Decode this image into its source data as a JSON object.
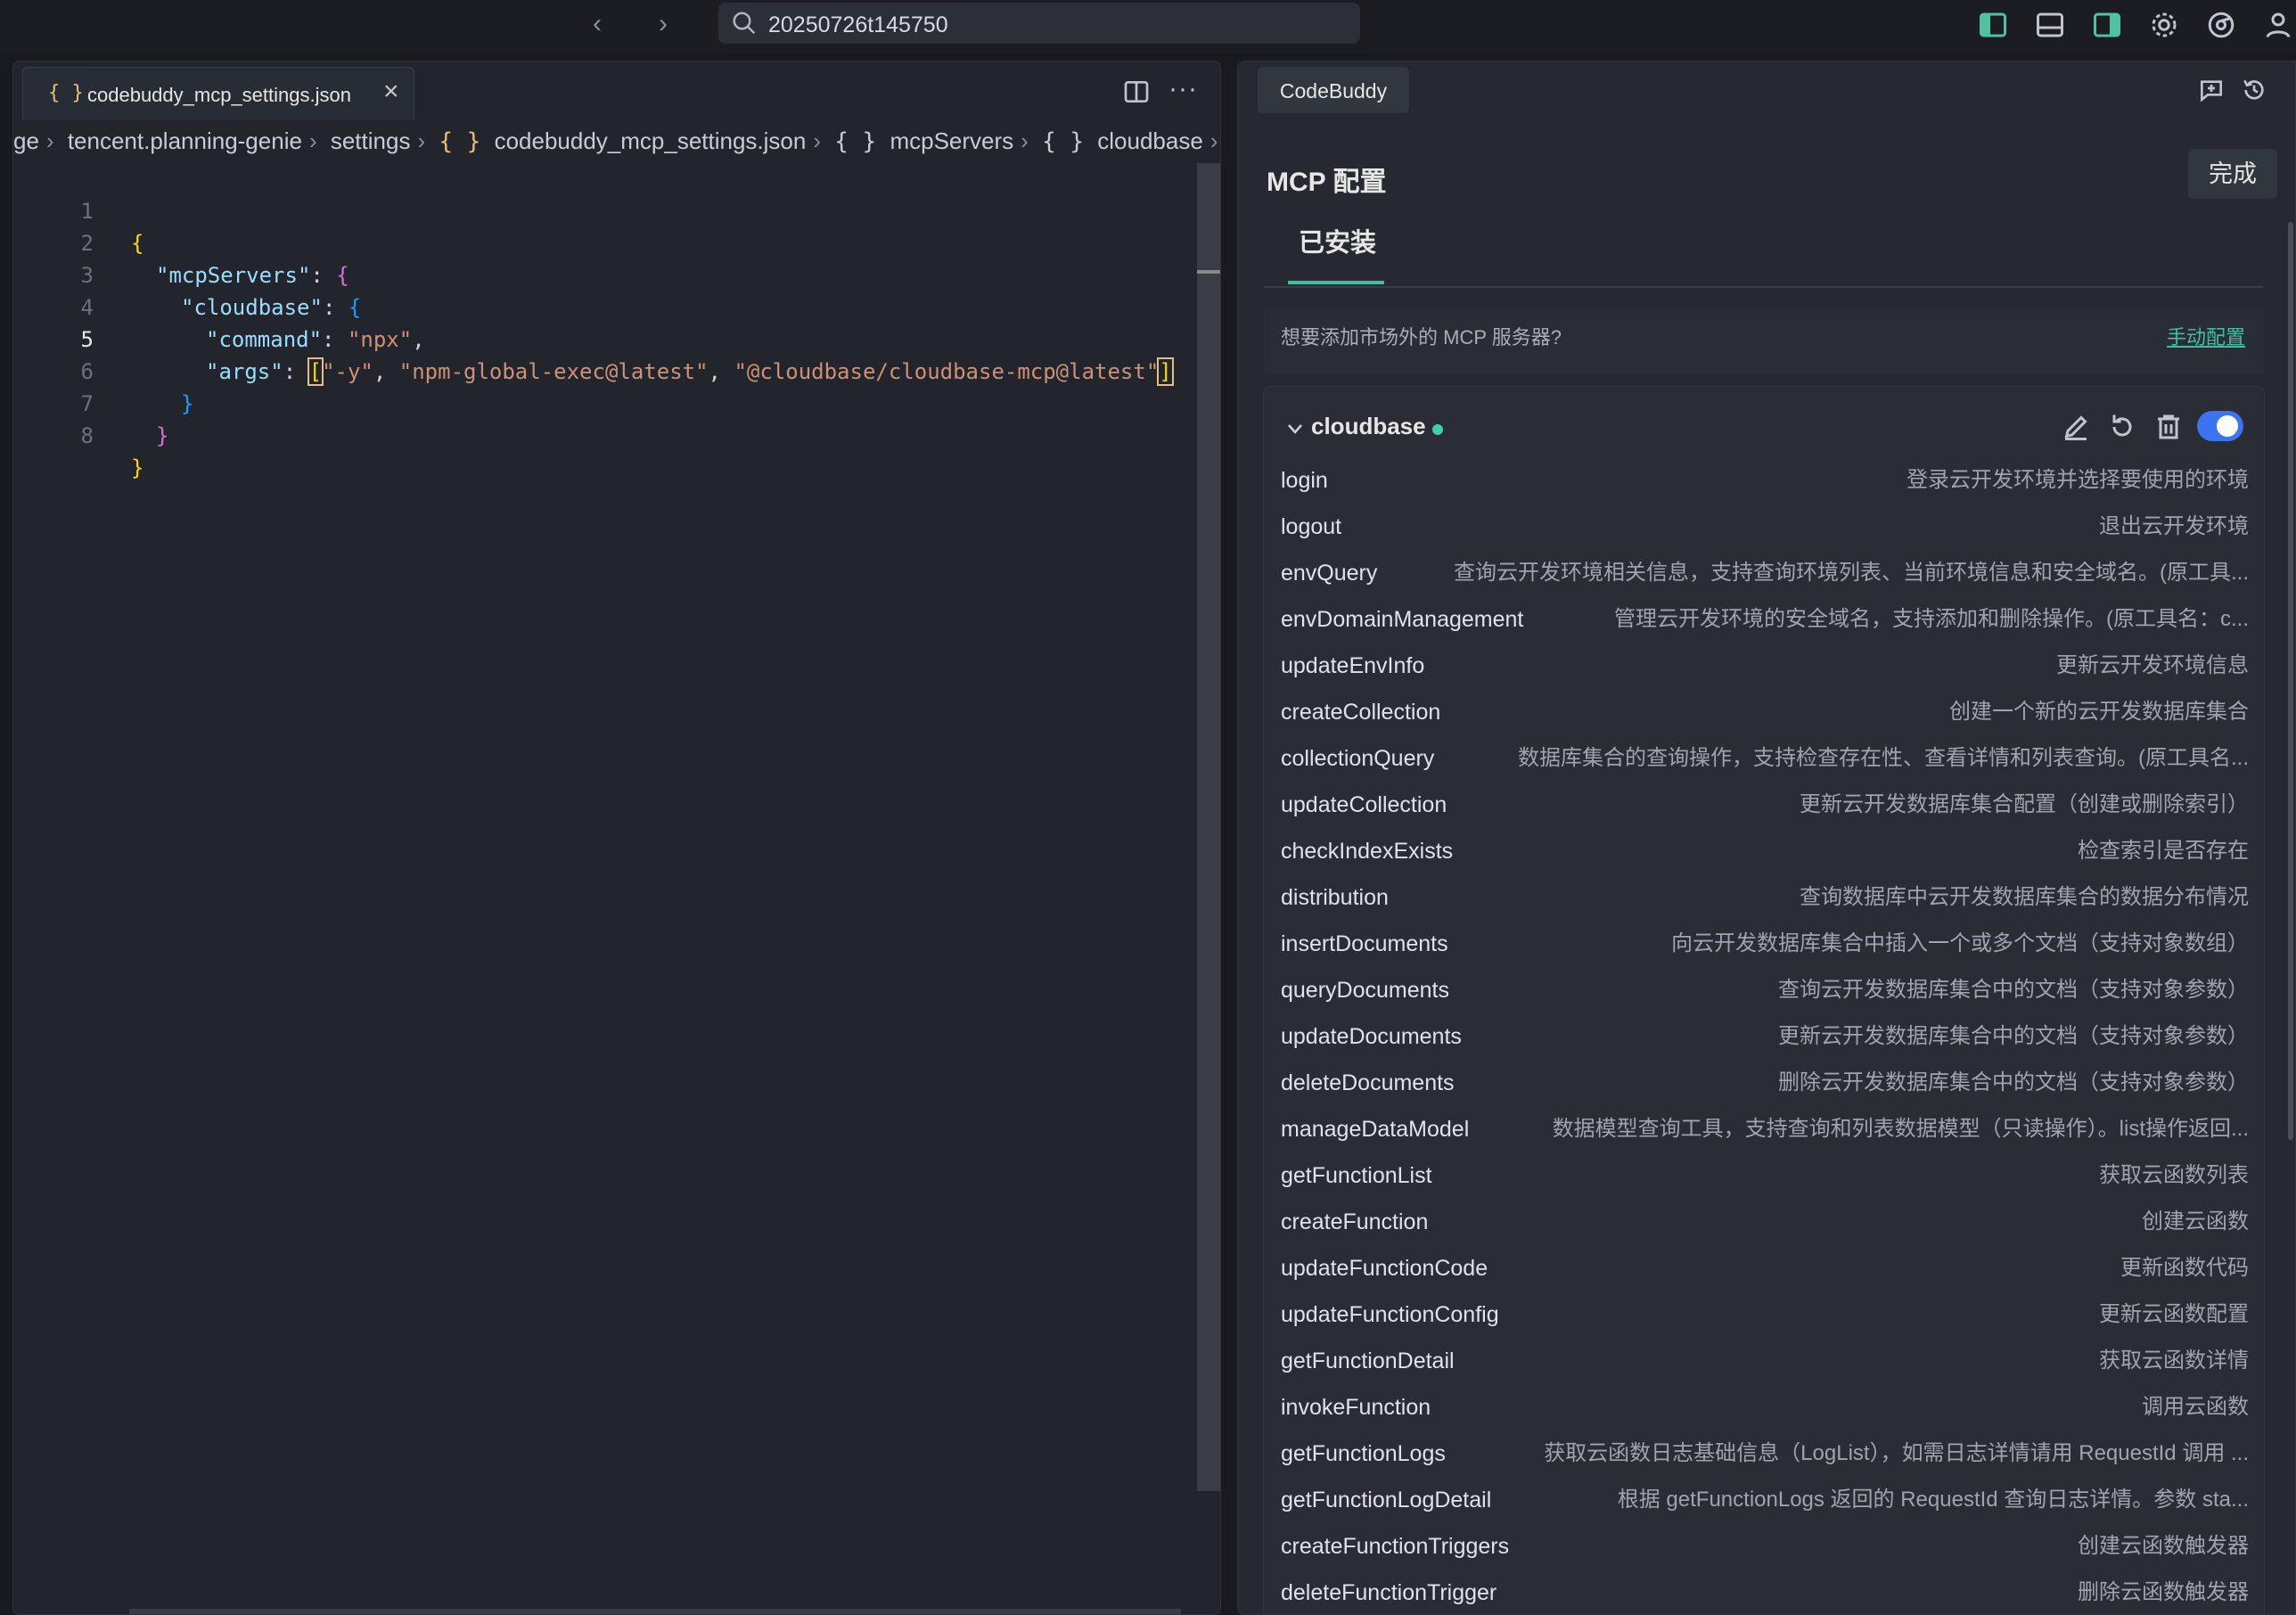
{
  "titlebar": {
    "search_text": "20250726t145750"
  },
  "editor": {
    "tab_icon": "{ }",
    "tab_name": "codebuddy_mcp_settings.json",
    "breadcrumb": [
      "ge",
      "tencent.planning-genie",
      "settings",
      "codebuddy_mcp_settings.json",
      "mcpServers",
      "cloudbase"
    ],
    "breadcrumb_icons": [
      "{ }",
      "{ }",
      "{ }"
    ],
    "lines": [
      {
        "n": "1",
        "text": "{"
      },
      {
        "n": "2",
        "text": "\"mcpServers\": {"
      },
      {
        "n": "3",
        "text": "\"cloudbase\": {"
      },
      {
        "n": "4",
        "text": "\"command\": \"npx\","
      },
      {
        "n": "5",
        "text": "\"args\": [\"-y\", \"npm-global-exec@latest\", \"@cloudbase/cloudbase-mcp@latest\"]"
      },
      {
        "n": "6",
        "text": "}"
      },
      {
        "n": "7",
        "text": "}"
      },
      {
        "n": "8",
        "text": "}"
      }
    ],
    "code_tokens": {
      "open_brace": "{",
      "close_brace": "}",
      "mcpServers_key": "\"mcpServers\"",
      "cloudbase_key": "\"cloudbase\"",
      "command_key": "\"command\"",
      "command_val": "\"npx\"",
      "args_key": "\"args\"",
      "arg1": "\"-y\"",
      "arg2": "\"npm-global-exec@latest\"",
      "arg3": "\"@cloudbase/cloudbase-mcp@latest\"",
      "colon": ": ",
      "comma": ",",
      "comma_space": ", ",
      "lbracket": "[",
      "rbracket": "]"
    }
  },
  "panel": {
    "tab_label": "CodeBuddy",
    "title": "MCP 配置",
    "done_label": "完成",
    "installed_tab": "已安装",
    "prompt": "想要添加市场外的 MCP 服务器?",
    "manual_link": "手动配置",
    "server_name": "cloudbase",
    "status_color": "#3fd0a8",
    "toggle_on": true,
    "accent_color": "#3b73f0",
    "tools": [
      {
        "name": "login",
        "desc": "登录云开发环境并选择要使用的环境"
      },
      {
        "name": "logout",
        "desc": "退出云开发环境"
      },
      {
        "name": "envQuery",
        "desc": "查询云开发环境相关信息，支持查询环境列表、当前环境信息和安全域名。(原工具..."
      },
      {
        "name": "envDomainManagement",
        "desc": "管理云开发环境的安全域名，支持添加和删除操作。(原工具名：c..."
      },
      {
        "name": "updateEnvInfo",
        "desc": "更新云开发环境信息"
      },
      {
        "name": "createCollection",
        "desc": "创建一个新的云开发数据库集合"
      },
      {
        "name": "collectionQuery",
        "desc": "数据库集合的查询操作，支持检查存在性、查看详情和列表查询。(原工具名..."
      },
      {
        "name": "updateCollection",
        "desc": "更新云开发数据库集合配置（创建或删除索引）"
      },
      {
        "name": "checkIndexExists",
        "desc": "检查索引是否存在"
      },
      {
        "name": "distribution",
        "desc": "查询数据库中云开发数据库集合的数据分布情况"
      },
      {
        "name": "insertDocuments",
        "desc": "向云开发数据库集合中插入一个或多个文档（支持对象数组）"
      },
      {
        "name": "queryDocuments",
        "desc": "查询云开发数据库集合中的文档（支持对象参数）"
      },
      {
        "name": "updateDocuments",
        "desc": "更新云开发数据库集合中的文档（支持对象参数）"
      },
      {
        "name": "deleteDocuments",
        "desc": "删除云开发数据库集合中的文档（支持对象参数）"
      },
      {
        "name": "manageDataModel",
        "desc": "数据模型查询工具，支持查询和列表数据模型（只读操作）。list操作返回..."
      },
      {
        "name": "getFunctionList",
        "desc": "获取云函数列表"
      },
      {
        "name": "createFunction",
        "desc": "创建云函数"
      },
      {
        "name": "updateFunctionCode",
        "desc": "更新函数代码"
      },
      {
        "name": "updateFunctionConfig",
        "desc": "更新云函数配置"
      },
      {
        "name": "getFunctionDetail",
        "desc": "获取云函数详情"
      },
      {
        "name": "invokeFunction",
        "desc": "调用云函数"
      },
      {
        "name": "getFunctionLogs",
        "desc": "获取云函数日志基础信息（LogList），如需日志详情请用 RequestId 调用 ..."
      },
      {
        "name": "getFunctionLogDetail",
        "desc": "根据 getFunctionLogs 返回的 RequestId 查询日志详情。参数 sta..."
      },
      {
        "name": "createFunctionTriggers",
        "desc": "创建云函数触发器"
      },
      {
        "name": "deleteFunctionTrigger",
        "desc": "删除云函数触发器"
      }
    ]
  }
}
